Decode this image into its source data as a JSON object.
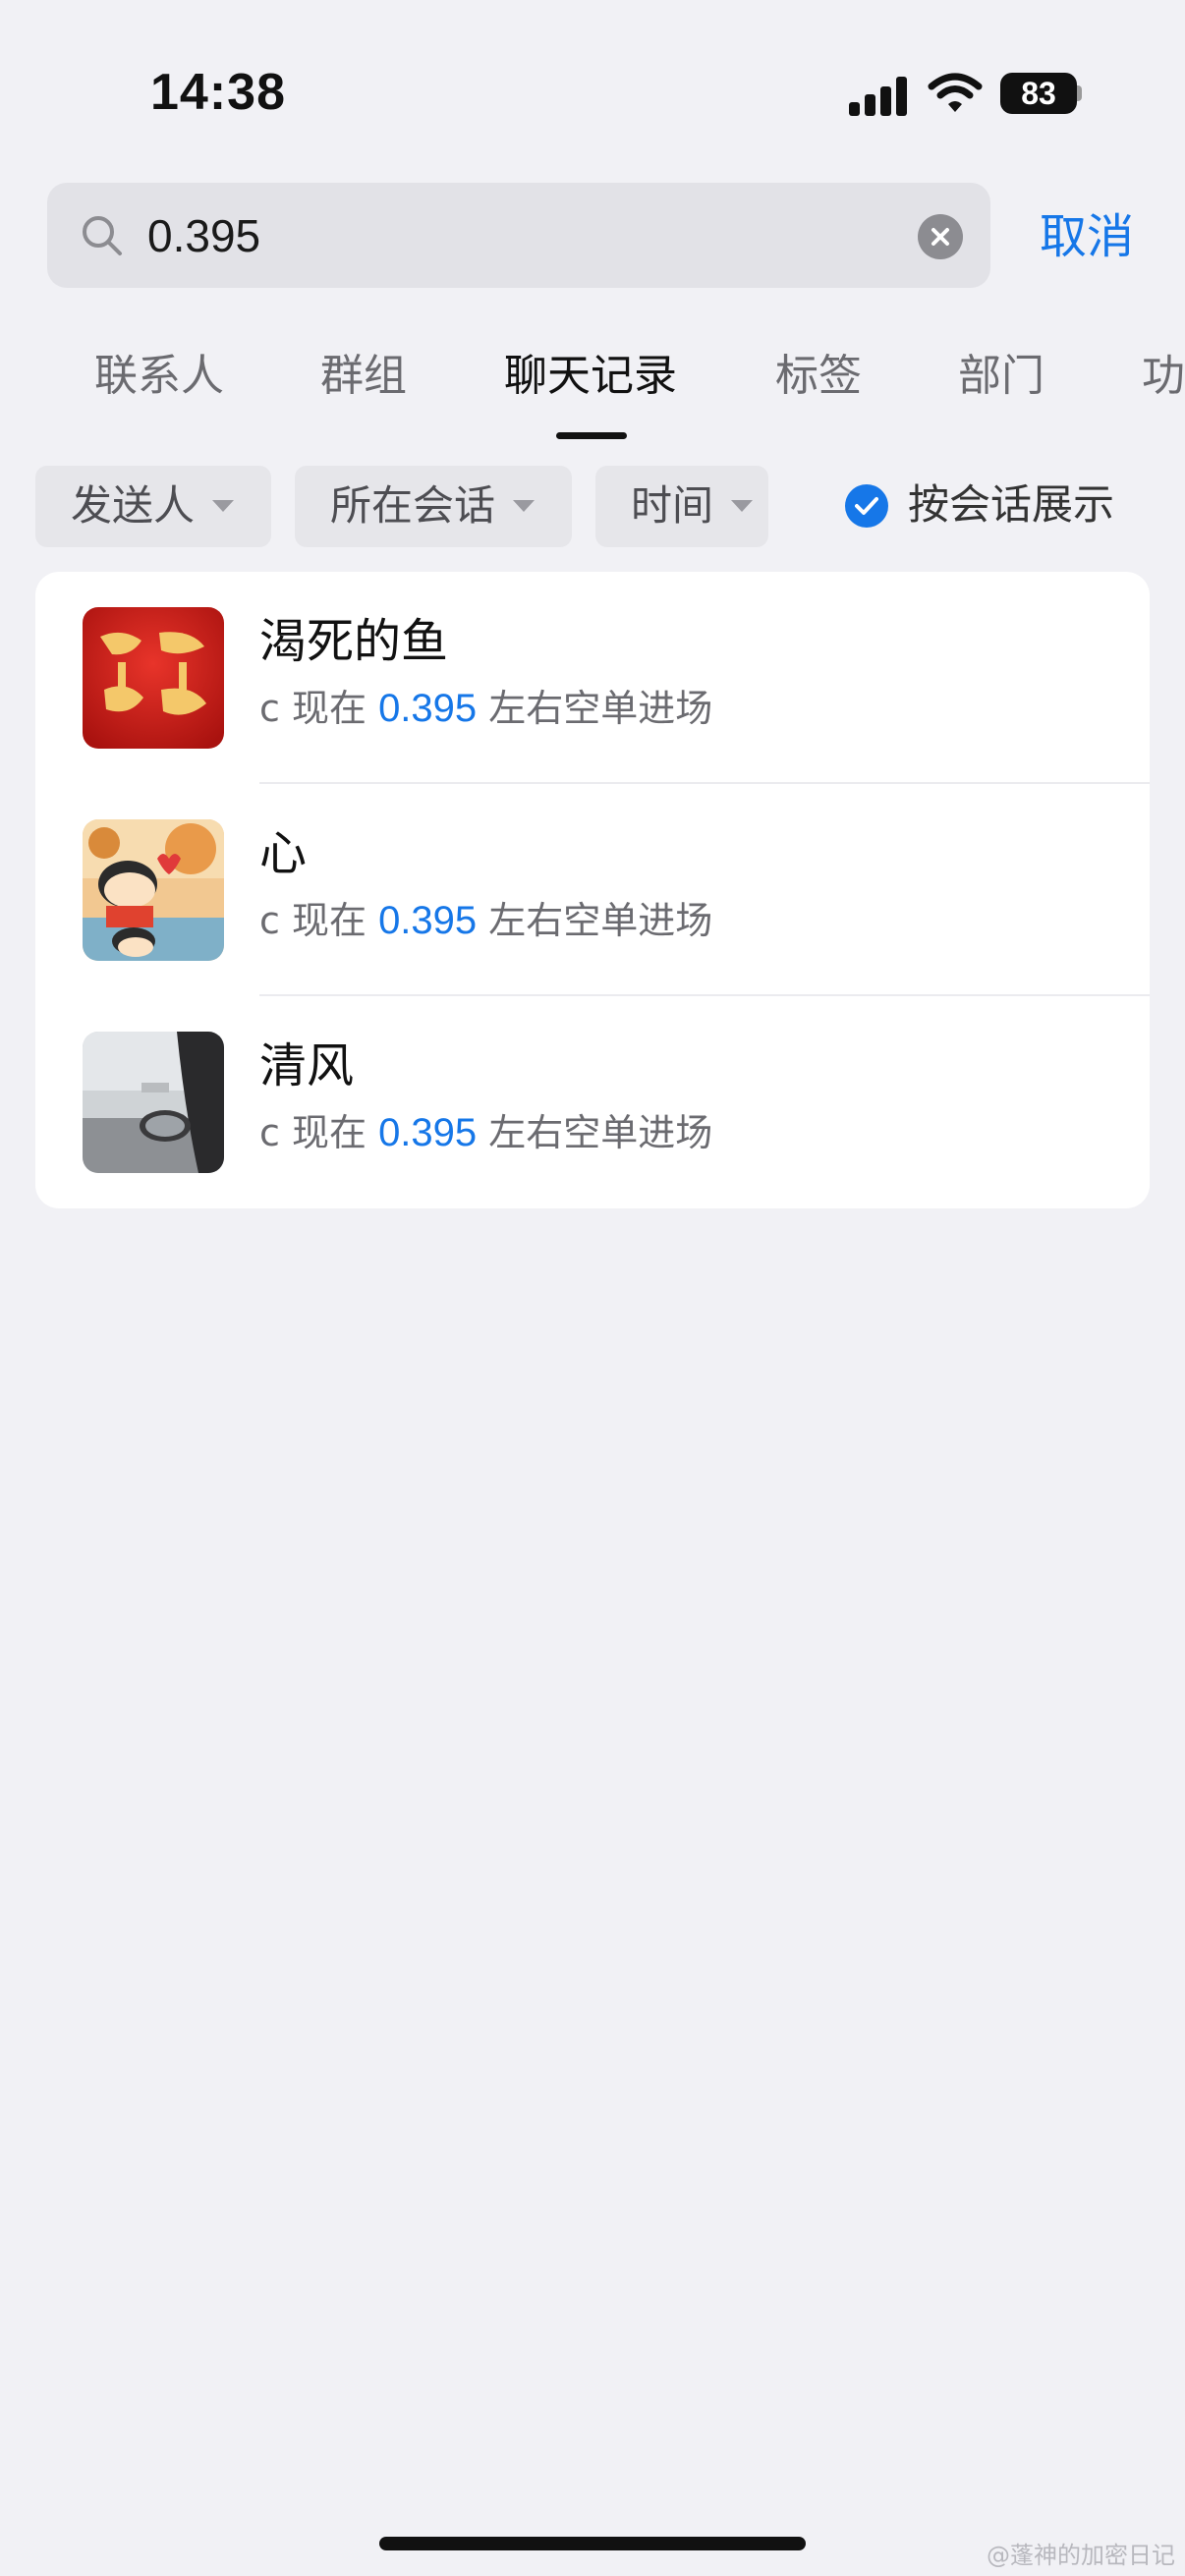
{
  "status_bar": {
    "time": "14:38",
    "battery": "83"
  },
  "search": {
    "value": "0.395",
    "cancel_label": "取消"
  },
  "tabs": [
    {
      "label": "联系人"
    },
    {
      "label": "群组"
    },
    {
      "label": "聊天记录",
      "active": true
    },
    {
      "label": "标签"
    },
    {
      "label": "部门"
    },
    {
      "label": "功"
    }
  ],
  "filters": {
    "sender": "发送人",
    "conversation": "所在会话",
    "time": "时间",
    "group_by_conversation": "按会话展示",
    "group_by_conversation_checked": true
  },
  "results": [
    {
      "name": "渴死的鱼",
      "snippet_pre": "c 现在 ",
      "snippet_match": "0.395",
      "snippet_post": " 左右空单进场",
      "avatar": "app-logo-qiancheng-sijin"
    },
    {
      "name": "心",
      "snippet_pre": "c 现在 ",
      "snippet_match": "0.395",
      "snippet_post": " 左右空单进场",
      "avatar": "cartoon-illustration"
    },
    {
      "name": "清风",
      "snippet_pre": "c 现在 ",
      "snippet_match": "0.395",
      "snippet_post": " 左右空单进场",
      "avatar": "car-side-mirror-photo"
    }
  ],
  "watermark": "@蓬神的加密日记",
  "colors": {
    "accent": "#1677e8",
    "background": "#f1f1f5"
  }
}
